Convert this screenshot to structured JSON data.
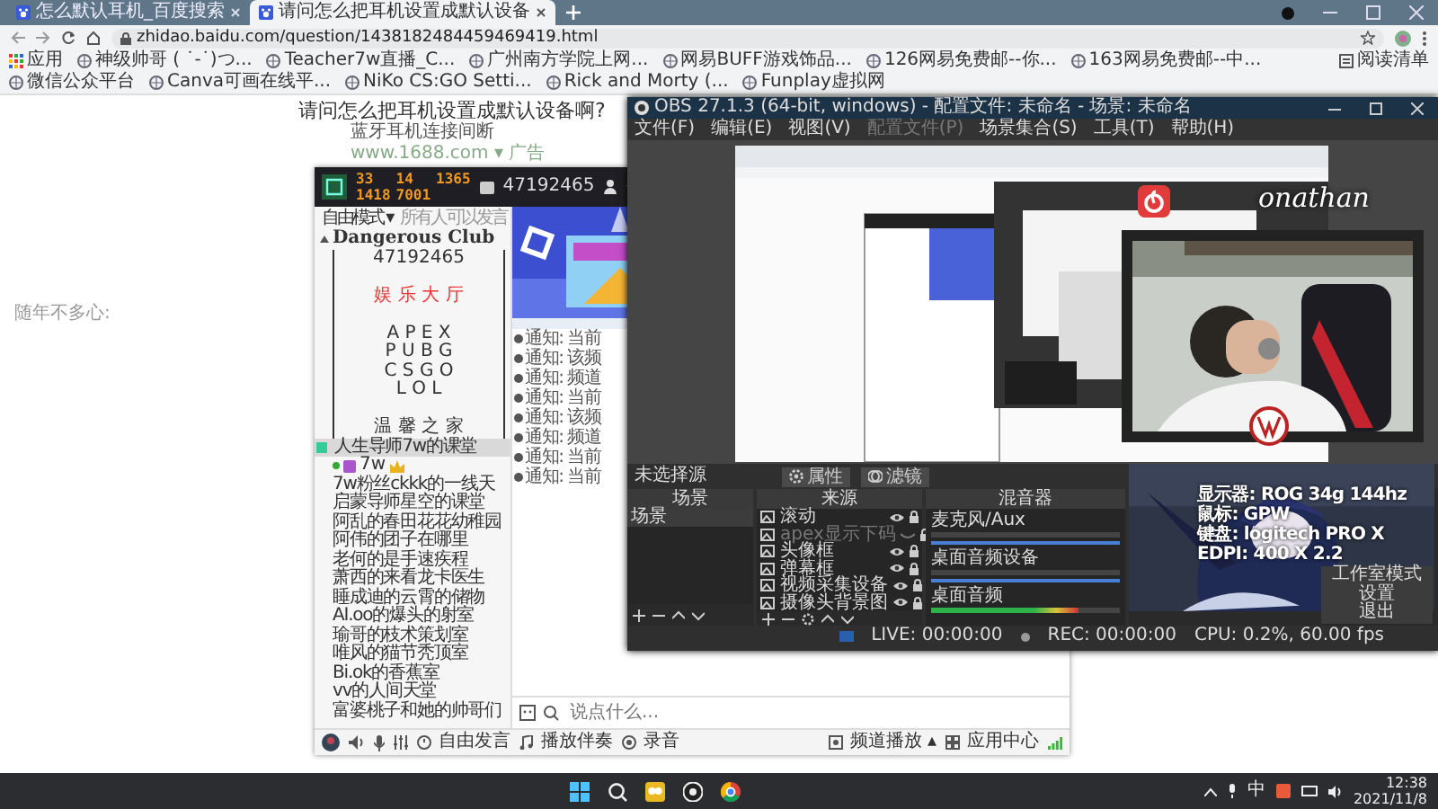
{
  "browser": {
    "tabs": [
      {
        "title": "怎么默认耳机_百度搜索",
        "selected": false
      },
      {
        "title": "请问怎么把耳机设置成默认设备",
        "selected": true
      }
    ],
    "url": "zhidao.baidu.com/question/1438182484459469419.html",
    "bookmarks": [
      "应用",
      "神级帅哥 ( ˙-˙)つ...",
      "Teacher7w直播_C...",
      "广州南方学院上网...",
      "网易BUFF游戏饰品...",
      "126网易免费邮--你...",
      "163网易免费邮--中...",
      "微信公众平台",
      "Canva可画在线平...",
      "NiKo CS:GO Setti...",
      "Rick and Morty (...",
      "Funplay虚拟网"
    ],
    "reading_list": "阅读清单"
  },
  "page": {
    "question": "请问怎么把耳机设置成默认设备啊?",
    "ad_text": "蓝牙耳机连接间断",
    "ad_source": "www.1688.com ▾ 广告",
    "side_text": "随年不多心:"
  },
  "voice_app": {
    "stats": [
      "33",
      "14",
      "1365",
      "1418",
      "7001"
    ],
    "channel_id": "47192465",
    "mode": "自由模式 ▾",
    "permission": "所有人可以发言",
    "channels": [
      {
        "label": "Dangerous Club",
        "kind": "group",
        "selected": false
      },
      {
        "label": "47192465",
        "kind": "top",
        "selected": false
      },
      {
        "kind": "spacer",
        "selected": false
      },
      {
        "label": "娱 乐 大 厅",
        "kind": "title",
        "selected": false
      },
      {
        "kind": "spacer",
        "selected": false
      },
      {
        "label": "A P E X",
        "kind": "line",
        "selected": false
      },
      {
        "label": "P U B G",
        "kind": "line",
        "selected": false
      },
      {
        "label": "C S G O",
        "kind": "line",
        "selected": false
      },
      {
        "label": "L O L",
        "kind": "line",
        "selected": false
      },
      {
        "kind": "spacer",
        "selected": false
      },
      {
        "label": "温 馨 之 家",
        "kind": "line",
        "selected": false
      },
      {
        "label": "人生导师7w的课堂",
        "kind": "room",
        "selected": true
      },
      {
        "label": "7w",
        "kind": "user",
        "selected": false
      },
      {
        "label": "7w粉丝ckkk的一线天",
        "kind": "room",
        "selected": false
      },
      {
        "label": "启蒙导师星空的课堂",
        "kind": "room",
        "selected": false
      },
      {
        "label": "阿乱的春田花花幼稚园",
        "kind": "room",
        "selected": false
      },
      {
        "label": "阿伟的团子在哪里",
        "kind": "room",
        "selected": false
      },
      {
        "label": "老何的是手速疾程",
        "kind": "room",
        "selected": false
      },
      {
        "label": "萧西的来看龙卡医生",
        "kind": "room",
        "selected": false
      },
      {
        "label": "睡成迪的云霄的储物",
        "kind": "room",
        "selected": false
      },
      {
        "label": "AI.oo的爆头的射室",
        "kind": "room",
        "selected": false
      },
      {
        "label": "瑜哥的枝术策划室",
        "kind": "room",
        "selected": false
      },
      {
        "label": "唯风的猫节秃顶室",
        "kind": "room",
        "selected": false
      },
      {
        "label": "Bi.ok的香蕉室",
        "kind": "room",
        "selected": false
      },
      {
        "label": "vv的人间天堂",
        "kind": "room",
        "selected": false
      },
      {
        "label": "富婆桃子和她的帅哥们",
        "kind": "room",
        "selected": false
      }
    ],
    "notices": [
      "通知: 当前",
      "通知: 该频",
      "通知: 频道",
      "通知: 当前",
      "通知: 该频",
      "通知: 频道",
      "通知: 当前",
      "通知: 当前"
    ],
    "input_placeholder": "说点什么...",
    "tools": [
      "自由发言",
      "播放伴奏",
      "录音"
    ],
    "right_tools": [
      "频道播放 ▴",
      "应用中心"
    ]
  },
  "obs": {
    "title": "OBS 27.1.3 (64-bit, windows) - 配置文件: 未命名 - 场景: 未命名",
    "menu": [
      {
        "label": "文件(F)",
        "disabled": false
      },
      {
        "label": "编辑(E)",
        "disabled": false
      },
      {
        "label": "视图(V)",
        "disabled": false
      },
      {
        "label": "配置文件(P)",
        "disabled": true
      },
      {
        "label": "场景集合(S)",
        "disabled": false
      },
      {
        "label": "工具(T)",
        "disabled": false
      },
      {
        "label": "帮助(H)",
        "disabled": false
      }
    ],
    "source_label": "未选择源",
    "source_buttons": [
      "属性",
      "滤镜"
    ],
    "scenes": {
      "title": "场景",
      "items": [
        {
          "name": "场景",
          "selected": true
        }
      ]
    },
    "sources": {
      "title": "来源",
      "items": [
        {
          "name": "滚动",
          "visible": true
        },
        {
          "name": "apex显示下码",
          "visible": false
        },
        {
          "name": "头像框",
          "visible": true
        },
        {
          "name": "弹幕框",
          "visible": true
        },
        {
          "name": "视频采集设备",
          "visible": true
        },
        {
          "name": "摄像头背景图",
          "visible": true
        }
      ]
    },
    "mixer": {
      "title": "混音器",
      "tracks": [
        {
          "name": "麦克风/Aux",
          "meter": {
            "level": 0
          },
          "volume": {
            "level": 1
          }
        },
        {
          "name": "桌面音频设备",
          "meter": {
            "level": 0
          },
          "volume": {
            "level": 1
          }
        },
        {
          "name": "桌面音频",
          "meter": {
            "level": 0.78
          }
        }
      ]
    },
    "status": [
      "LIVE: 00:00:00",
      "REC: 00:00:00",
      "CPU: 0.2%, 60.00 fps"
    ]
  },
  "overlay": {
    "name": "onathan",
    "specs": [
      "显示器: ROG 34g 144hz",
      "鼠标: GPW",
      "键盘: logitech PRO X",
      "EDPI: 400 X 2.2"
    ],
    "controls": [
      "工作室模式",
      "设置",
      "退出"
    ]
  },
  "taskbar": {
    "ime": "中",
    "time": "12:38",
    "date": "2021/11/8"
  }
}
